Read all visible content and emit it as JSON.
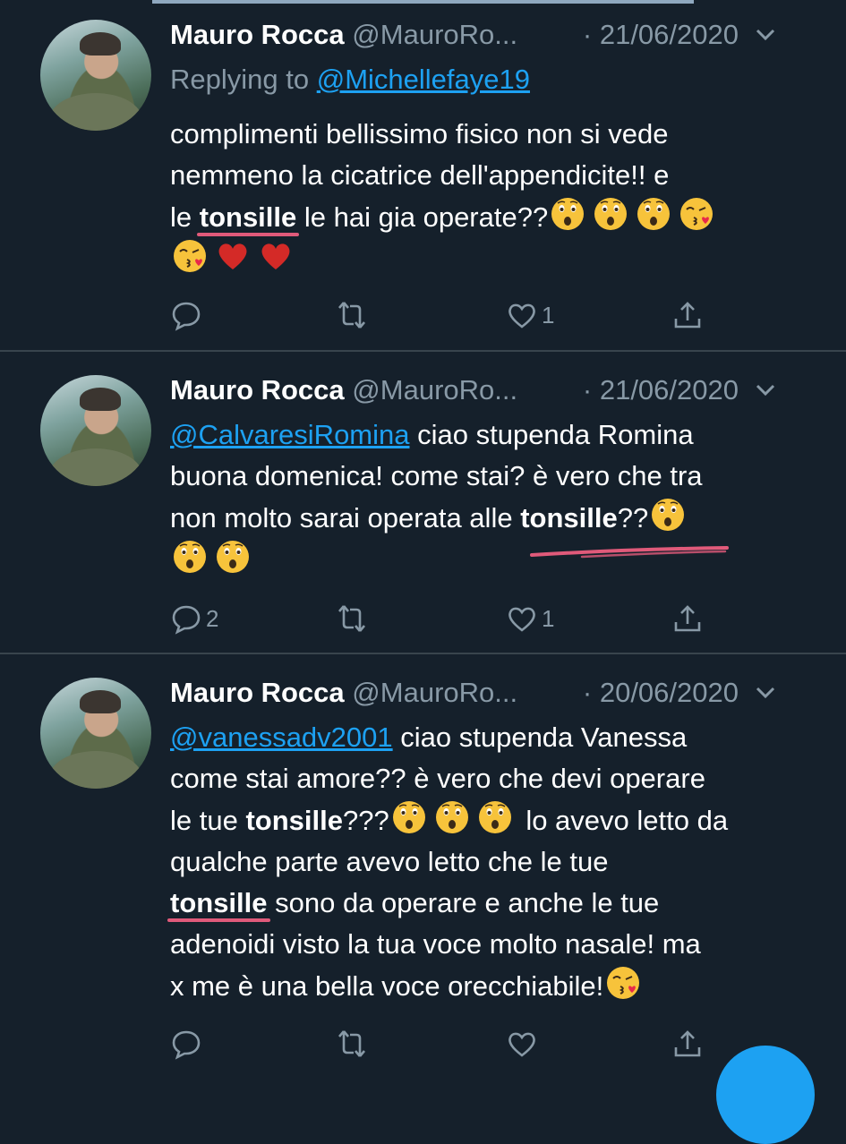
{
  "tweets": [
    {
      "name": "Mauro Rocca",
      "handle": "@MauroRo...",
      "date": "· 21/06/2020",
      "replying_prefix": "Replying to ",
      "replying_to": "@Michellefaye19",
      "text": {
        "l1": "complimenti bellissimo fisico non si vede",
        "l2": "nemmeno la cicatrice dell'appendicite!! e",
        "l3a": "le ",
        "l3b": "tonsille",
        "l3c": " le hai gia operate??"
      },
      "actions": {
        "reply_count": "",
        "retweet_count": "",
        "like_count": "1"
      }
    },
    {
      "name": "Mauro Rocca",
      "handle": "@MauroRo...",
      "date": "· 21/06/2020",
      "text": {
        "mention": "@CalvaresiRomina",
        "l1": " ciao stupenda Romina",
        "l2": "buona domenica! come stai? è vero che tra",
        "l3a": "non molto sarai operata alle ",
        "l3b": "tonsille",
        "l3c": "??"
      },
      "actions": {
        "reply_count": "2",
        "retweet_count": "",
        "like_count": "1"
      }
    },
    {
      "name": "Mauro Rocca",
      "handle": "@MauroRo...",
      "date": "· 20/06/2020",
      "text": {
        "mention": "@vanessadv2001",
        "l1": " ciao stupenda Vanessa",
        "l2": "come stai amore?? è vero che devi operare",
        "l3a": "le tue ",
        "l3b": "tonsille",
        "l3c": "???",
        "l3d": " lo avevo letto da",
        "l4": "qualche parte avevo letto che le tue",
        "l5a": "tonsille",
        "l5b": " sono da operare e anche le tue",
        "l6": "adenoidi visto la tua voce molto nasale! ma",
        "l7": "x me è una bella voce orecchiabile!"
      },
      "actions": {
        "reply_count": "",
        "retweet_count": "",
        "like_count": ""
      }
    }
  ],
  "colors": {
    "background": "#15202b",
    "link": "#1da1f2",
    "secondary": "#8899a6",
    "highlight": "#e05a7a"
  },
  "icons": [
    "reply-icon",
    "retweet-icon",
    "like-icon",
    "share-icon",
    "chevron-down-icon",
    "astonished-emoji",
    "kiss-emoji",
    "heart-emoji"
  ]
}
